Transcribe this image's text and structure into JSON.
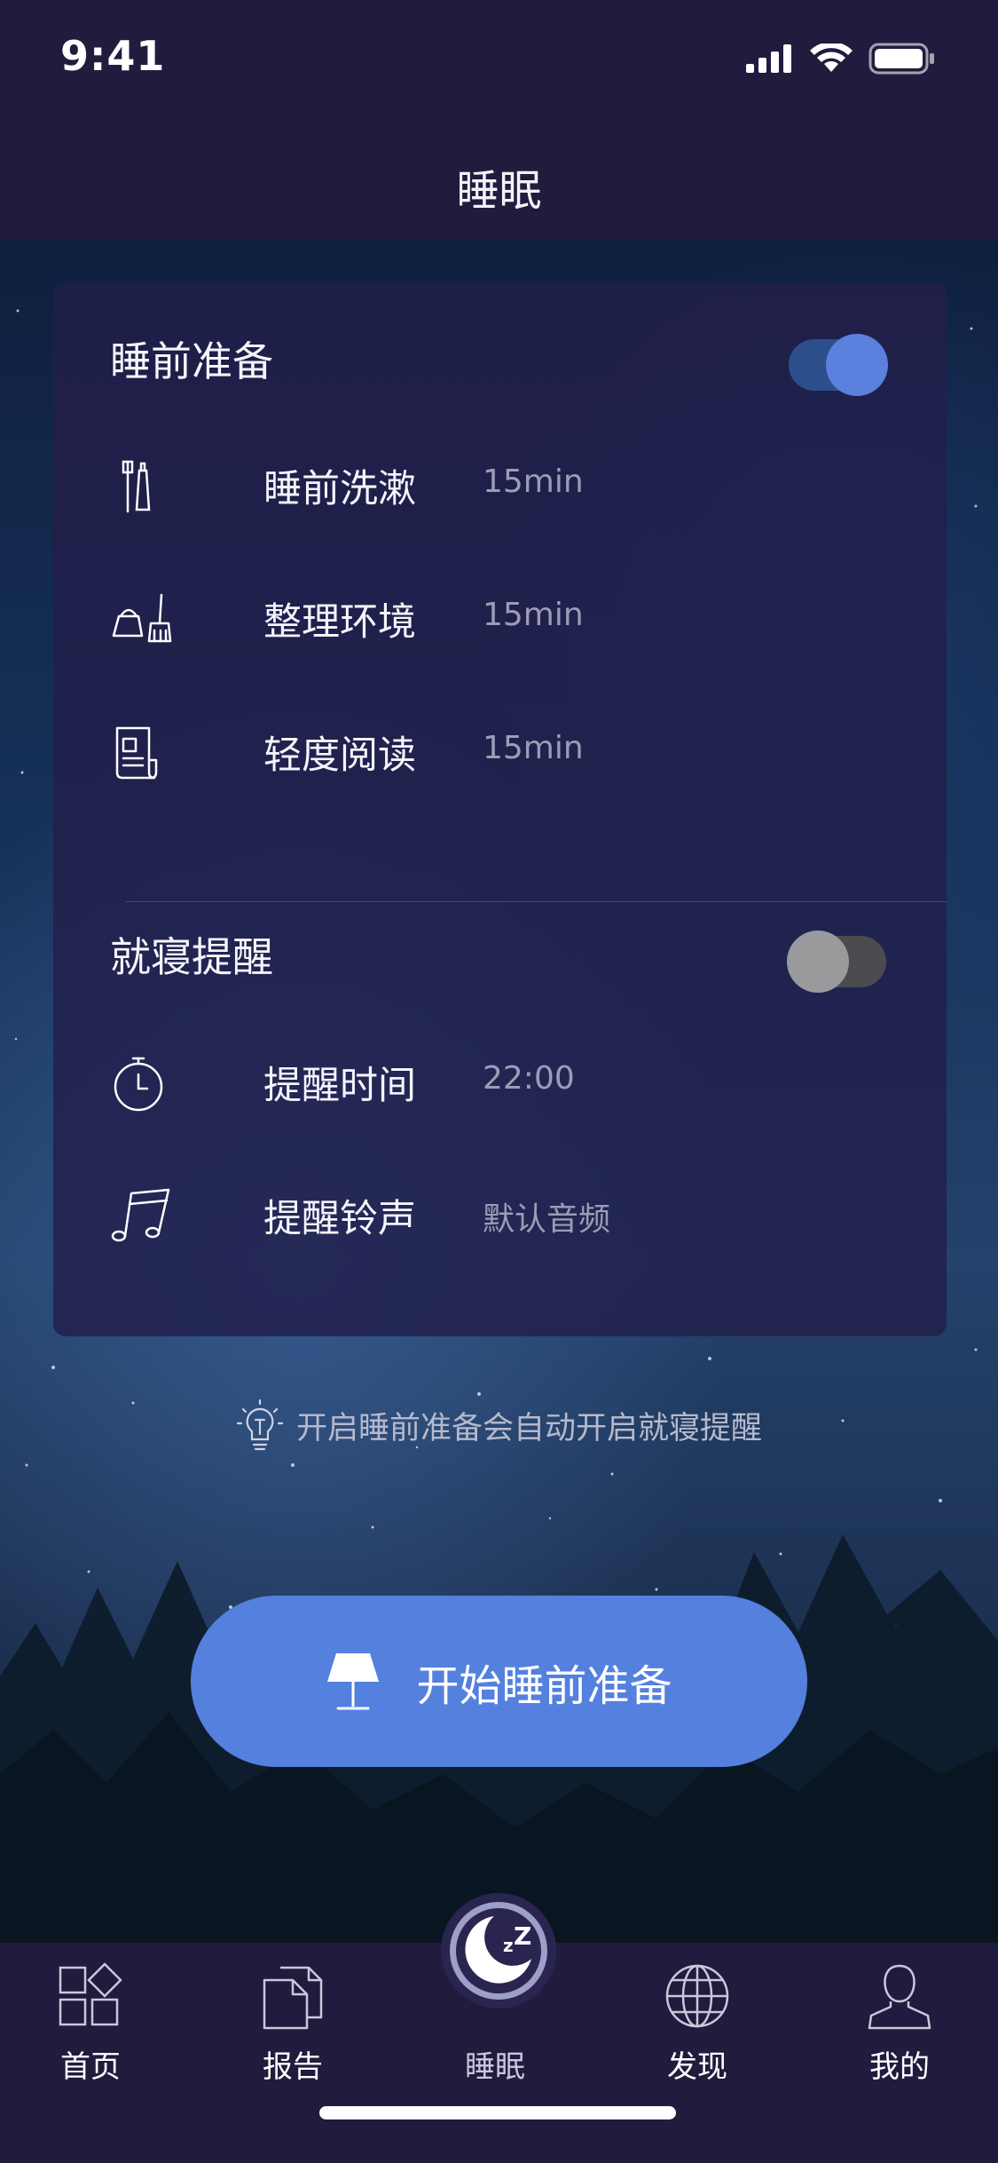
{
  "status_bar": {
    "time": "9:41"
  },
  "nav": {
    "title": "睡眠"
  },
  "prep": {
    "title": "睡前准备",
    "toggle_on": true,
    "items": [
      {
        "icon": "toothbrush-icon",
        "label": "睡前洗漱",
        "value": "15min"
      },
      {
        "icon": "cleaning-icon",
        "label": "整理环境",
        "value": "15min"
      },
      {
        "icon": "book-icon",
        "label": "轻度阅读",
        "value": "15min"
      }
    ]
  },
  "reminder": {
    "title": "就寝提醒",
    "toggle_on": false,
    "items": [
      {
        "icon": "stopwatch-icon",
        "label": "提醒时间",
        "value": "22:00"
      },
      {
        "icon": "music-note-icon",
        "label": "提醒铃声",
        "value": "默认音频"
      }
    ]
  },
  "hint": {
    "icon": "lightbulb-icon",
    "text": "开启睡前准备会自动开启就寝提醒"
  },
  "start_button": {
    "icon": "lamp-icon",
    "label": "开始睡前准备"
  },
  "tabs": [
    {
      "icon": "grid-icon",
      "label": "首页"
    },
    {
      "icon": "documents-icon",
      "label": "报告"
    },
    {
      "icon": "moon-icon",
      "label": "睡眠",
      "active": true
    },
    {
      "icon": "globe-icon",
      "label": "发现"
    },
    {
      "icon": "user-icon",
      "label": "我的"
    }
  ],
  "colors": {
    "background": "#211b3e",
    "card": "#221f4b",
    "accent": "#5480de",
    "muted_text": "#9d9cb6"
  }
}
